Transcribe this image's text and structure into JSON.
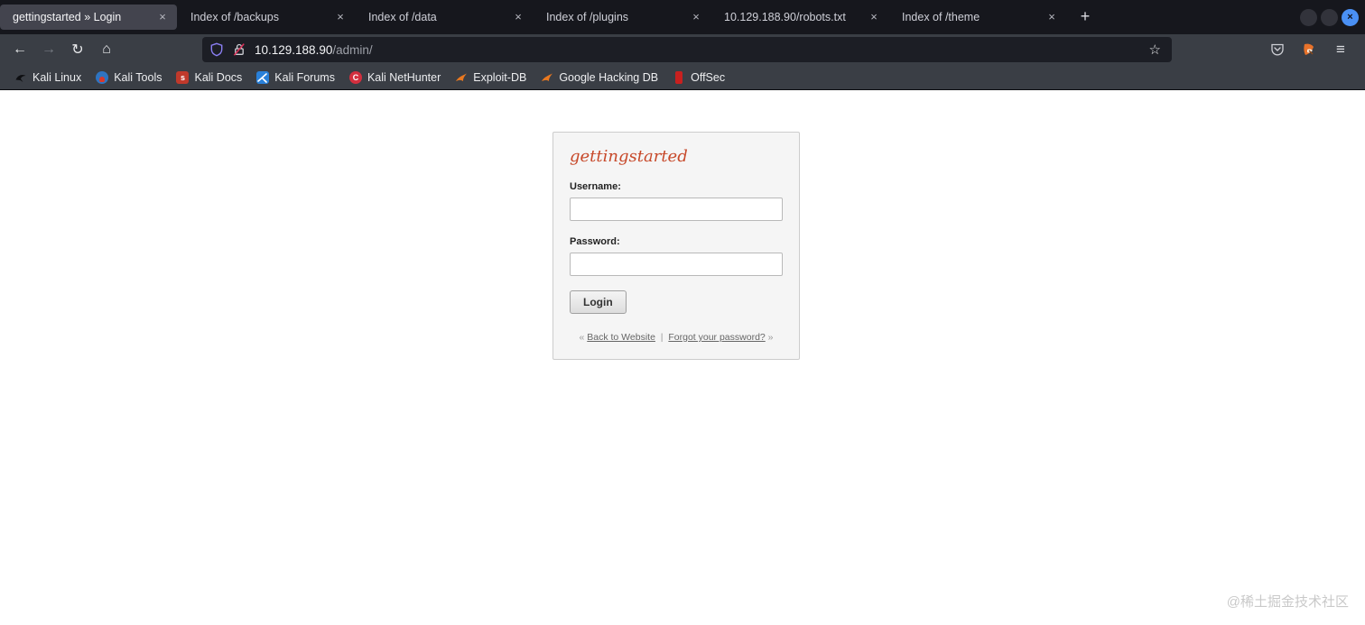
{
  "tabs": [
    {
      "label": "gettingstarted » Login",
      "active": true
    },
    {
      "label": "Index of /backups",
      "active": false
    },
    {
      "label": "Index of /data",
      "active": false
    },
    {
      "label": "Index of /plugins",
      "active": false
    },
    {
      "label": "10.129.188.90/robots.txt",
      "active": false
    },
    {
      "label": "Index of /theme",
      "active": false
    }
  ],
  "tabbar": {
    "close_glyph": "×",
    "new_tab_glyph": "+"
  },
  "window_controls": {
    "close_glyph": "×"
  },
  "navbar": {
    "back_glyph": "←",
    "forward_glyph": "→",
    "reload_glyph": "↻",
    "home_glyph": "⌂",
    "star_glyph": "☆",
    "menu_glyph": "≡",
    "url_host": "10.129.188.90",
    "url_path": "/admin/"
  },
  "bookmarks": [
    {
      "label": "Kali Linux",
      "icon": "kali-dragon-icon"
    },
    {
      "label": "Kali Tools",
      "icon": "kali-tools-icon"
    },
    {
      "label": "Kali Docs",
      "icon": "kali-docs-icon",
      "badge": "s"
    },
    {
      "label": "Kali Forums",
      "icon": "kali-forums-icon"
    },
    {
      "label": "Kali NetHunter",
      "icon": "kali-nethunter-icon",
      "badge": "C"
    },
    {
      "label": "Exploit-DB",
      "icon": "exploit-db-bird-icon"
    },
    {
      "label": "Google Hacking DB",
      "icon": "ghdb-bird-icon"
    },
    {
      "label": "OffSec",
      "icon": "offsec-icon"
    }
  ],
  "page": {
    "login_card": {
      "title": "gettingstarted",
      "username_label": "Username:",
      "password_label": "Password:",
      "username_value": "",
      "password_value": "",
      "login_button": "Login",
      "footer": {
        "laquo": "«",
        "back_link": "Back to Website",
        "pipe": "|",
        "forgot_link": "Forgot your password?",
        "raquo": "»"
      }
    },
    "watermark": "@稀土掘金技术社区"
  },
  "colors": {
    "tabbar_bg": "#16171d",
    "active_tab_bg": "#43444e",
    "toolbar_bg": "#3a3e45",
    "url_field_bg": "#1c1e25",
    "close_button_accent": "#4a90f4",
    "shield_icon": "#8b7ff4",
    "lock_slash": "#e0335b",
    "card_title": "#c7492a",
    "card_bg": "#f5f5f5",
    "link": "#666666",
    "bookmark_orange": "#e87820",
    "bookmark_red": "#c0392b",
    "bookmark_blue": "#2980d9"
  }
}
